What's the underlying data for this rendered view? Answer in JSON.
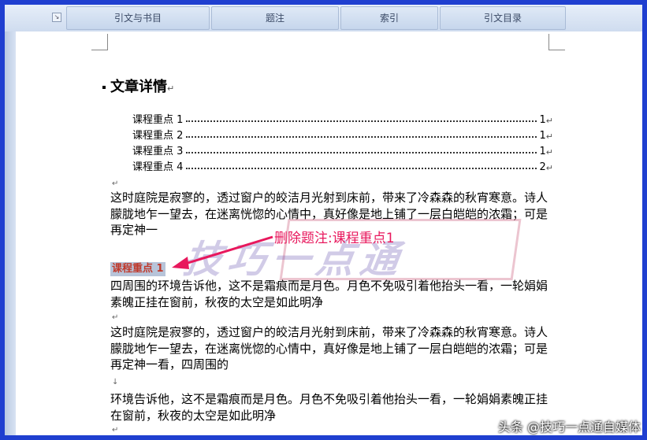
{
  "ribbon": {
    "buttons": [
      "引文与书目",
      "题注",
      "索引",
      "引文目录"
    ]
  },
  "document": {
    "heading": "文章详情",
    "toc": [
      {
        "label": "课程重点 1",
        "page": "1"
      },
      {
        "label": "课程重点 2",
        "page": "1"
      },
      {
        "label": "课程重点 3",
        "page": "1"
      },
      {
        "label": "课程重点 4",
        "page": "2"
      }
    ],
    "para1": "这时庭院是寂寥的，透过窗户的皎洁月光射到床前，带来了冷森森的秋宵寒意。诗人朦胧地乍一望去，在迷离恍惚的心情中，真好像是地上铺了一层白皑皑的浓霜；可是再定神一",
    "caption": "课程重点 1",
    "para2": "四周围的环境告诉他，这不是霜痕而是月色。月色不免吸引着他抬头一看，一轮娟娟素魄正挂在窗前，秋夜的太空是如此明净",
    "para3": "这时庭院是寂寥的，透过窗户的皎洁月光射到床前，带来了冷森森的秋宵寒意。诗人朦胧地乍一望去，在迷离恍惚的心情中，真好像是地上铺了一层白皑皑的浓霜；可是再定神一看，四周围的",
    "para4": "环境告诉他，这不是霜痕而是月色。月色不免吸引着他抬头一看，一轮娟娟素魄正挂在窗前，秋夜的太空是如此明净"
  },
  "annotation": "删除题注:课程重点1",
  "watermark": "技巧一点通",
  "credit": "头条 @技巧一点通自媒体",
  "marks": {
    "paragraph": "↵",
    "line": "↓"
  }
}
